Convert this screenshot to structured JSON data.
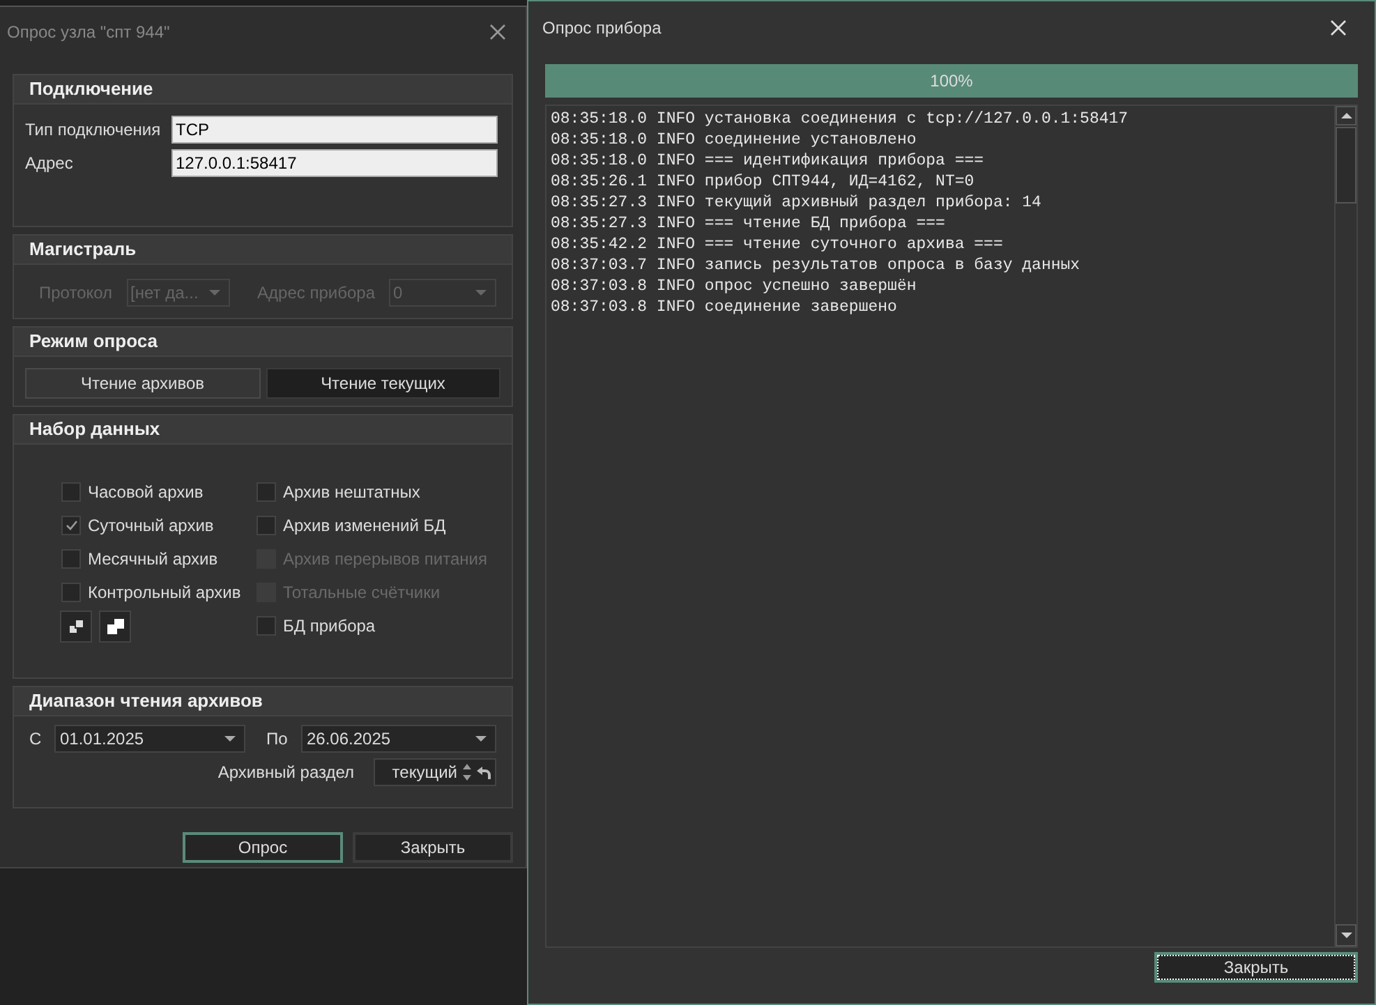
{
  "poll_node_dialog": {
    "title": "Опрос узла \"спт 944\"",
    "connection": {
      "title": "Подключение",
      "fields": [
        {
          "label": "Тип подключения",
          "value": "TCP"
        },
        {
          "label": "Адрес",
          "value": "127.0.0.1:58417"
        }
      ]
    },
    "trunk": {
      "title": "Магистраль",
      "disabled": true,
      "protocol": {
        "label": "Протокол",
        "value": "[нет да..."
      },
      "device_address": {
        "label": "Адрес прибора",
        "value": "0"
      }
    },
    "poll_mode": {
      "title": "Режим опроса",
      "options": [
        {
          "label": "Чтение архивов",
          "selected": true
        },
        {
          "label": "Чтение текущих",
          "selected": false
        }
      ]
    },
    "data_set": {
      "title": "Набор данных",
      "columns": [
        [
          {
            "label": "Часовой архив",
            "checked": false,
            "disabled": false
          },
          {
            "label": "Суточный архив",
            "checked": true,
            "disabled": false
          },
          {
            "label": "Месячный архив",
            "checked": false,
            "disabled": false
          },
          {
            "label": "Контрольный архив",
            "checked": false,
            "disabled": false
          }
        ],
        [
          {
            "label": "Архив нештатных",
            "checked": false,
            "disabled": false
          },
          {
            "label": "Архив изменений БД",
            "checked": false,
            "disabled": false
          },
          {
            "label": "Архив перерывов питания",
            "checked": false,
            "disabled": true
          },
          {
            "label": "Тотальные счётчики",
            "checked": false,
            "disabled": true
          },
          {
            "label": "БД прибора",
            "checked": false,
            "disabled": false
          }
        ]
      ]
    },
    "range": {
      "title": "Диапазон чтения архивов",
      "from": {
        "label": "С",
        "value": "01.01.2025"
      },
      "to": {
        "label": "По",
        "value": "26.06.2025"
      },
      "section": {
        "label": "Архивный раздел",
        "value": "текущий"
      }
    },
    "buttons": [
      {
        "label": "Опрос",
        "focused": true
      },
      {
        "label": "Закрыть",
        "focused": false
      }
    ]
  },
  "device_poll_dialog": {
    "title": "Опрос прибора",
    "progress": {
      "level": 1,
      "text": "100%"
    },
    "log": [
      "08:35:18.0 INFO установка соединения с tcp://127.0.0.1:58417",
      "08:35:18.0 INFO соединение установлено",
      "08:35:18.0 INFO === идентификация прибора ===",
      "08:35:26.1 INFO прибор СПТ944, ИД=4162, NT=0",
      "08:35:27.3 INFO текущий архивный раздел прибора: 14",
      "08:35:27.3 INFO === чтение БД прибора ===",
      "08:35:42.2 INFO === чтение суточного архива ===",
      "08:37:03.7 INFO запись результатов опроса в базу данных",
      "08:37:03.8 INFO опрос успешно завершён",
      "08:37:03.8 INFO соединение завершено"
    ],
    "close_button": {
      "label": "Закрыть",
      "focused": true
    }
  }
}
